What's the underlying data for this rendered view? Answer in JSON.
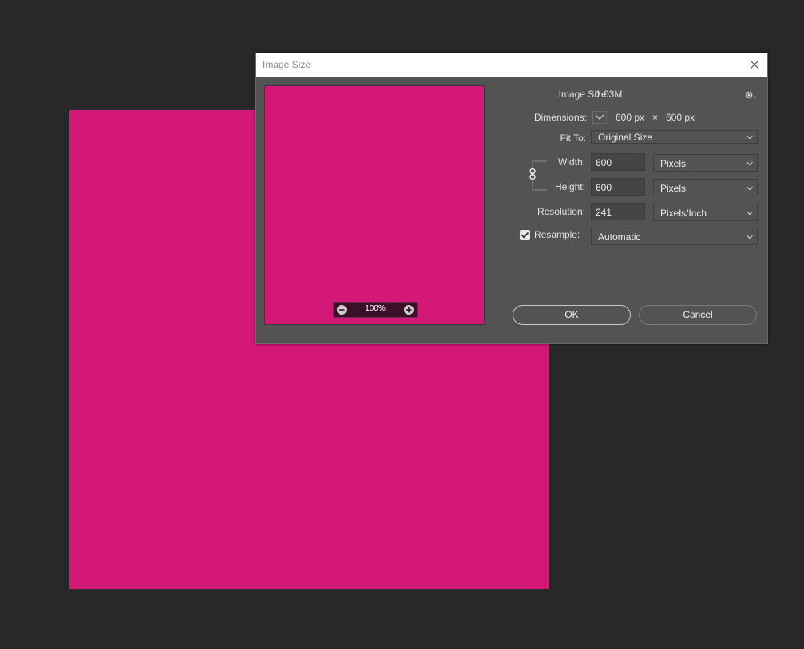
{
  "dialog": {
    "title": "Image Size",
    "image_size_label": "Image Size:",
    "image_size_value": "1.03M",
    "dimensions_label": "Dimensions:",
    "dimensions_width": "600 px",
    "dimensions_times": "×",
    "dimensions_height": "600 px",
    "fit_to_label": "Fit To:",
    "fit_to_value": "Original Size",
    "width_label": "Width:",
    "width_value": "600",
    "width_unit": "Pixels",
    "height_label": "Height:",
    "height_value": "600",
    "height_unit": "Pixels",
    "resolution_label": "Resolution:",
    "resolution_value": "241",
    "resolution_unit": "Pixels/Inch",
    "resample_label": "Resample:",
    "resample_checked": true,
    "resample_value": "Automatic",
    "ok_label": "OK",
    "cancel_label": "Cancel"
  },
  "preview": {
    "zoom": "100%",
    "color": "#d41877"
  },
  "colors": {
    "workspace": "#282828",
    "dialog_bg": "#535353",
    "document_fill": "#d41877"
  },
  "icons": {
    "close": "close-icon",
    "gear": "gear-icon",
    "zoom_out": "zoom-out-icon",
    "zoom_in": "zoom-in-icon",
    "link": "chain-link-icon",
    "dimensions_toggle": "chevron-down-icon",
    "checkbox": "checkmark-icon"
  }
}
